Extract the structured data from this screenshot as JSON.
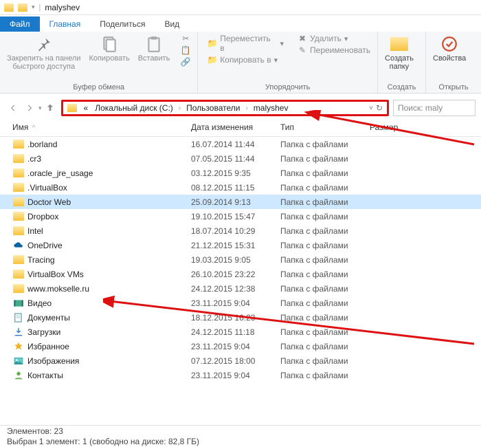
{
  "window": {
    "title": "malyshev"
  },
  "tabs": {
    "file": "Файл",
    "home": "Главная",
    "share": "Поделиться",
    "view": "Вид"
  },
  "ribbon": {
    "pin": "Закрепить на панели\nбыстрого доступа",
    "copy": "Копировать",
    "paste": "Вставить",
    "clipboard_label": "Буфер обмена",
    "move_to": "Переместить в",
    "copy_to": "Копировать в",
    "delete": "Удалить",
    "rename": "Переименовать",
    "organize_label": "Упорядочить",
    "new_folder": "Создать\nпапку",
    "create_label": "Создать",
    "properties": "Свойства",
    "open_label": "Открыть"
  },
  "breadcrumb": {
    "prefix": "«",
    "parts": [
      "Локальный диск (C:)",
      "Пользователи",
      "malyshev"
    ]
  },
  "search_placeholder": "Поиск: maly",
  "columns": {
    "name": "Имя",
    "date": "Дата изменения",
    "type": "Тип",
    "size": "Размер"
  },
  "type_folder": "Папка с файлами",
  "items": [
    {
      "icon": "folder",
      "name": ".borland",
      "date": "16.07.2014 11:44"
    },
    {
      "icon": "folder",
      "name": ".cr3",
      "date": "07.05.2015 11:44"
    },
    {
      "icon": "folder",
      "name": ".oracle_jre_usage",
      "date": "03.12.2015 9:35"
    },
    {
      "icon": "folder",
      "name": ".VirtualBox",
      "date": "08.12.2015 11:15"
    },
    {
      "icon": "folder",
      "name": "Doctor Web",
      "date": "25.09.2014 9:13",
      "selected": true
    },
    {
      "icon": "folder",
      "name": "Dropbox",
      "date": "19.10.2015 15:47"
    },
    {
      "icon": "folder",
      "name": "Intel",
      "date": "18.07.2014 10:29"
    },
    {
      "icon": "onedrive",
      "name": "OneDrive",
      "date": "21.12.2015 15:31"
    },
    {
      "icon": "folder",
      "name": "Tracing",
      "date": "19.03.2015 9:05"
    },
    {
      "icon": "folder",
      "name": "VirtualBox VMs",
      "date": "26.10.2015 23:22"
    },
    {
      "icon": "folder",
      "name": "www.mokselle.ru",
      "date": "24.12.2015 12:38"
    },
    {
      "icon": "video",
      "name": "Видео",
      "date": "23.11.2015 9:04"
    },
    {
      "icon": "docs",
      "name": "Документы",
      "date": "18.12.2015 16:23"
    },
    {
      "icon": "downloads",
      "name": "Загрузки",
      "date": "24.12.2015 11:18"
    },
    {
      "icon": "star",
      "name": "Избранное",
      "date": "23.11.2015 9:04"
    },
    {
      "icon": "images",
      "name": "Изображения",
      "date": "07.12.2015 18:00"
    },
    {
      "icon": "contacts",
      "name": "Контакты",
      "date": "23.11.2015 9:04"
    }
  ],
  "status": {
    "line1": "Элементов: 23",
    "line2": "Выбран 1 элемент: 1 (свободно на диске: 82,8 ГБ)"
  }
}
